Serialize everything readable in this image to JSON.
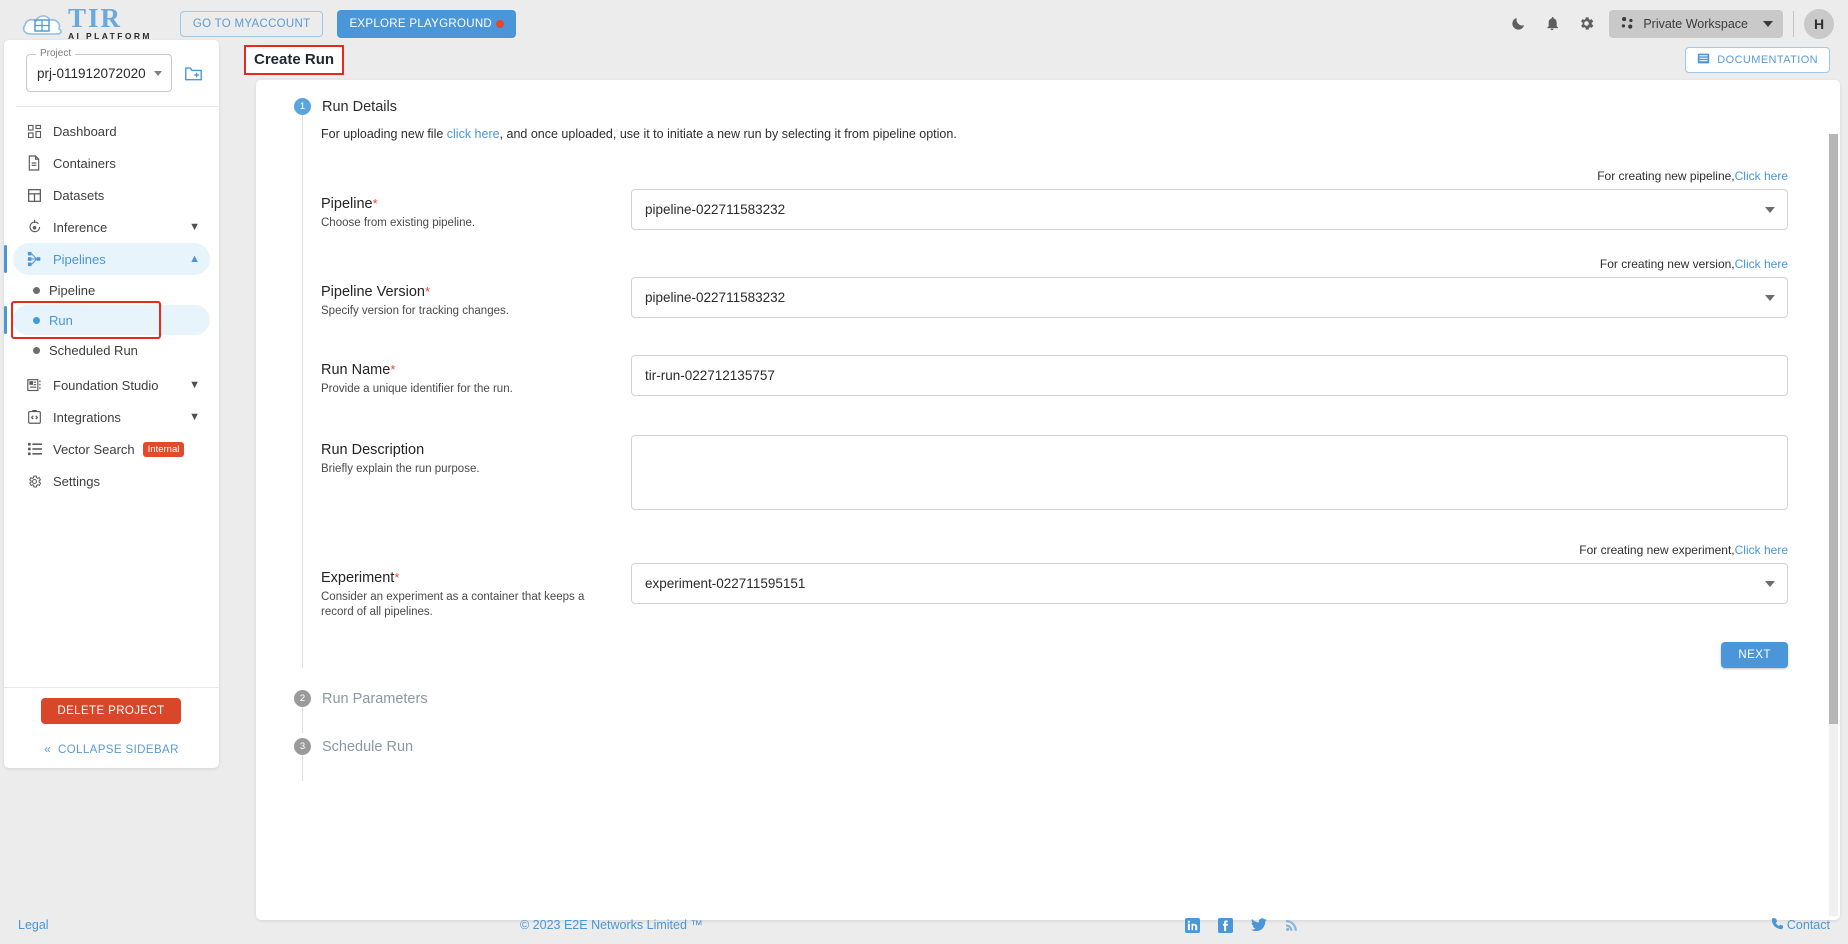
{
  "header": {
    "logo_main": "TIR",
    "logo_sub": "AI PLATFORM",
    "myaccount_label": "GO TO MYACCOUNT",
    "playground_label": "EXPLORE PLAYGROUND",
    "workspace_label": "Private Workspace",
    "avatar_initial": "H",
    "icons": {
      "moon": "dark-mode-icon",
      "bell": "notifications-icon",
      "gear": "settings-icon",
      "workspace": "workspace-icon"
    }
  },
  "sidebar": {
    "project_legend": "Project",
    "project_value": "prj-011912072020",
    "items": [
      {
        "label": "Dashboard",
        "icon": "dashboard-icon",
        "expandable": false,
        "active": false
      },
      {
        "label": "Containers",
        "icon": "containers-icon",
        "expandable": false,
        "active": false
      },
      {
        "label": "Datasets",
        "icon": "datasets-icon",
        "expandable": false,
        "active": false
      },
      {
        "label": "Inference",
        "icon": "inference-icon",
        "expandable": true,
        "active": false
      },
      {
        "label": "Pipelines",
        "icon": "pipelines-icon",
        "expandable": true,
        "active": true
      }
    ],
    "sub_items": [
      {
        "label": "Pipeline",
        "active": false
      },
      {
        "label": "Run",
        "active": true
      },
      {
        "label": "Scheduled Run",
        "active": false
      }
    ],
    "items_after": [
      {
        "label": "Foundation Studio",
        "icon": "foundation-studio-icon",
        "expandable": true
      },
      {
        "label": "Integrations",
        "icon": "integrations-icon",
        "expandable": true
      },
      {
        "label": "Vector Search",
        "icon": "vector-search-icon",
        "expandable": false,
        "badge": "Internal"
      },
      {
        "label": "Settings",
        "icon": "settings-gear-icon",
        "expandable": false
      }
    ],
    "delete_project_label": "DELETE PROJECT",
    "collapse_label": "COLLAPSE SIDEBAR"
  },
  "main": {
    "page_title": "Create Run",
    "documentation_label": "DOCUMENTATION",
    "step1": {
      "number": "1",
      "title": "Run Details",
      "note_pre": "For uploading new file ",
      "note_link": "click here",
      "note_post": ", and once uploaded, use it to initiate a new run by selecting it from pipeline option.",
      "pipeline": {
        "hint_text": "For creating new pipeline,",
        "hint_link": "Click here",
        "label": "Pipeline",
        "required": "*",
        "desc": "Choose from existing pipeline.",
        "value": "pipeline-022711583232"
      },
      "version": {
        "hint_text": "For creating new version,",
        "hint_link": "Click here",
        "label": "Pipeline Version",
        "required": "*",
        "desc": "Specify version for tracking changes.",
        "value": "pipeline-022711583232"
      },
      "run_name": {
        "label": "Run Name",
        "required": "*",
        "desc": "Provide a unique identifier for the run.",
        "value": "tir-run-022712135757"
      },
      "run_description": {
        "label": "Run Description",
        "desc": "Briefly explain the run purpose.",
        "value": "",
        "placeholder": ""
      },
      "experiment": {
        "hint_text": "For creating new experiment,",
        "hint_link": "Click here",
        "label": "Experiment",
        "required": "*",
        "desc": "Consider an experiment as a container that keeps a record of all pipelines.",
        "value": "experiment-022711595151"
      },
      "next_label": "NEXT"
    },
    "step2": {
      "number": "2",
      "title": "Run Parameters"
    },
    "step3": {
      "number": "3",
      "title": "Schedule Run"
    }
  },
  "footer": {
    "legal": "Legal",
    "copyright": "© 2023 E2E Networks Limited ™",
    "contact": "Contact",
    "social": [
      "linkedin-icon",
      "facebook-icon",
      "twitter-icon",
      "rss-icon"
    ]
  },
  "colors": {
    "accent_blue": "#4a96d9",
    "danger_red": "#d9472b",
    "highlight_outline": "#e8291c",
    "page_bg": "#ececec"
  }
}
